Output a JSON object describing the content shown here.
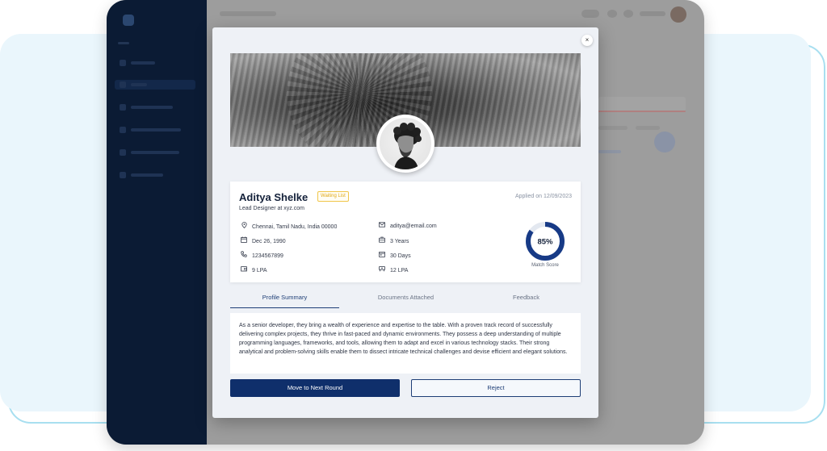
{
  "modal": {
    "close_label": "×",
    "candidate": {
      "name": "Aditya Shelke",
      "status": "Waiting List",
      "role": "Lead Designer at xyz.com",
      "applied": "Applied on 12/09/2023"
    },
    "details": {
      "location": "Chennai, Tamil Nadu, India 00000",
      "dob": "Dec 26, 1990",
      "phone": "1234567899",
      "current_salary": "9 LPA",
      "email": "aditya@email.com",
      "experience": "3 Years",
      "notice_period": "30 Days",
      "expected_salary": "12 LPA"
    },
    "match": {
      "percent": 85,
      "percent_label": "85%",
      "label": "Match Score"
    },
    "tabs": [
      {
        "label": "Profile Summary",
        "active": true
      },
      {
        "label": "Documents Attached",
        "active": false
      },
      {
        "label": "Feedback",
        "active": false
      }
    ],
    "summary": "As a senior developer, they bring a wealth of experience and expertise to the table. With a proven track record of successfully delivering complex projects, they thrive in fast-paced and dynamic environments. They possess a deep understanding of multiple programming languages, frameworks, and tools, allowing them to adapt and excel in various technology stacks. Their strong analytical and problem-solving skills enable them to dissect intricate technical challenges and devise efficient and elegant solutions.",
    "actions": {
      "next_round": "Move to Next Round",
      "reject": "Reject"
    }
  },
  "colors": {
    "primary": "#0f2f6b",
    "sidebar": "#0b1b34",
    "badge": "#f0c64a",
    "ring": "#173a86",
    "ring_track": "#e3e8f0"
  },
  "icons": {
    "location": "location-pin-icon",
    "dob": "calendar-icon",
    "phone": "phone-icon",
    "current_salary": "wallet-icon",
    "email": "mail-icon",
    "experience": "briefcase-icon",
    "notice_period": "calendar-clock-icon",
    "expected_salary": "money-icon",
    "close": "close-icon"
  }
}
